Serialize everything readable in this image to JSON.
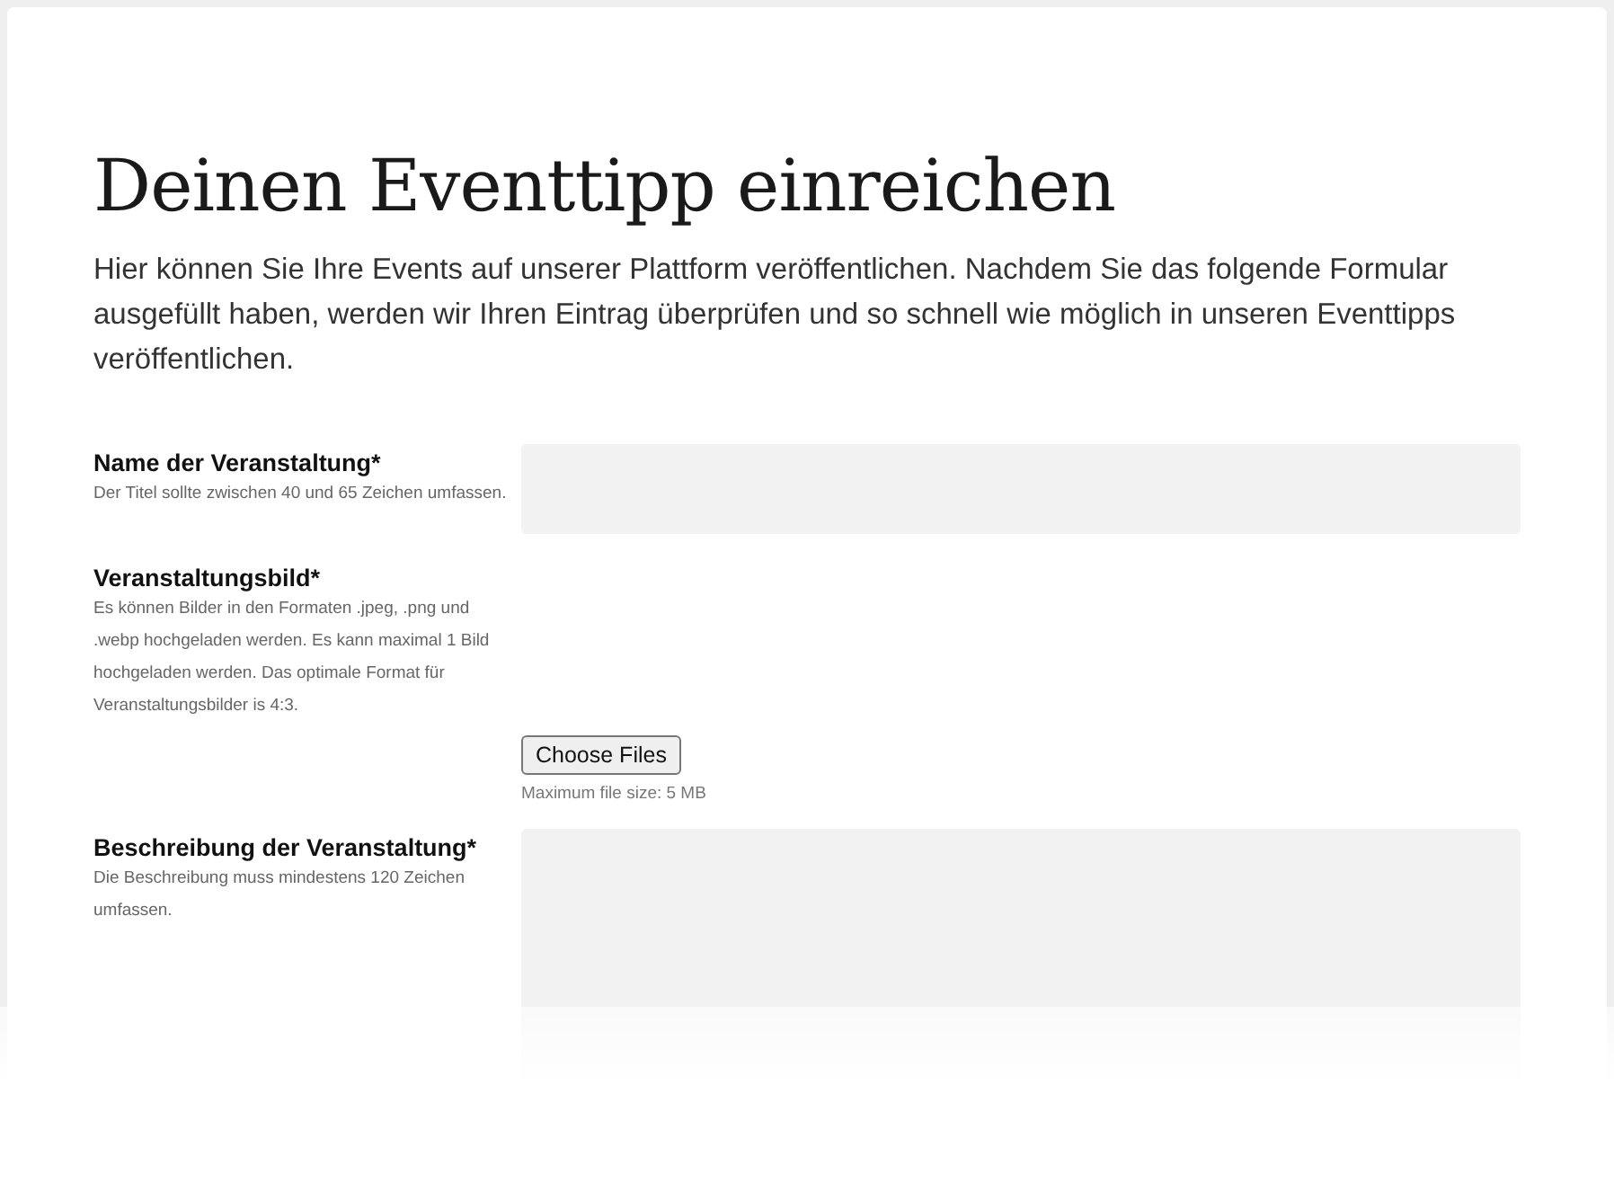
{
  "title": "Deinen Eventtipp einreichen",
  "intro": "Hier können Sie Ihre Events auf unserer Plattform veröffentlichen. Nachdem Sie das folgende Formular ausgefüllt haben, werden wir Ihren Eintrag überprüfen und so schnell wie möglich in unseren Eventtipps veröffentlichen.",
  "fields": [
    {
      "kind": "text",
      "label": "Name der Veranstaltung*",
      "help": "Der Titel sollte zwischen 40 und 65 Zeichen umfassen."
    },
    {
      "kind": "file",
      "label": "Veranstaltungsbild*",
      "help": "Es können Bilder in den Formaten .jpeg, .png und .webp hochgeladen werden. Es kann maximal 1 Bild hochgeladen werden. Das optimale Format für Veranstaltungsbilder is 4:3.",
      "button": "Choose Files",
      "note": "Maximum file size: 5 MB"
    },
    {
      "kind": "textarea",
      "label": "Beschreibung der Veranstaltung*",
      "help": "Die Beschreibung muss mindestens 120 Zeichen umfassen."
    }
  ]
}
